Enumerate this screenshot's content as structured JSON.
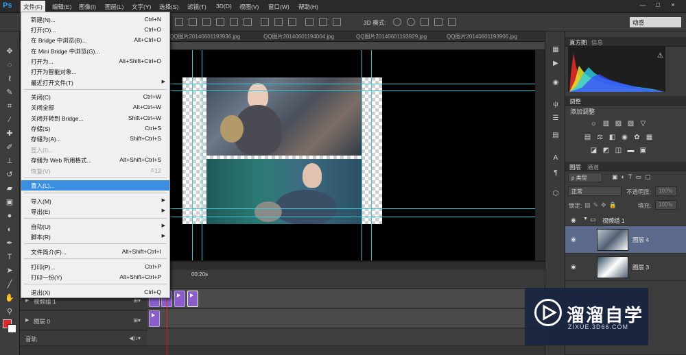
{
  "menubar": {
    "logo": "Ps",
    "items": [
      "文件(F)",
      "编辑(E)",
      "图像(I)",
      "图层(L)",
      "文字(Y)",
      "选择(S)",
      "滤镜(T)",
      "3D(D)",
      "视图(V)",
      "窗口(W)",
      "帮助(H)"
    ],
    "window_buttons": [
      "—",
      "□",
      "×"
    ]
  },
  "options_bar": {
    "mode3d_label": "3D 模式:",
    "workspace": "动感"
  },
  "doc_tabs": [
    "QQ图片20140601193936.jpg",
    "QQ图片20140601194004.jpg",
    "QQ图片20140601193929.jpg",
    "QQ图片20140601193906.jpg"
  ],
  "file_menu": {
    "items": [
      {
        "label": "新建(N)...",
        "shortcut": "Ctrl+N"
      },
      {
        "label": "打开(O)...",
        "shortcut": "Ctrl+O"
      },
      {
        "label": "在 Bridge 中浏览(B)...",
        "shortcut": "Alt+Ctrl+O"
      },
      {
        "label": "在 Mini Bridge 中浏览(G)...",
        "shortcut": ""
      },
      {
        "label": "打开为...",
        "shortcut": "Alt+Shift+Ctrl+O"
      },
      {
        "label": "打开为智能对象...",
        "shortcut": ""
      },
      {
        "label": "最近打开文件(T)",
        "shortcut": ""
      },
      {
        "label": "关闭(C)",
        "shortcut": "Ctrl+W"
      },
      {
        "label": "关闭全部",
        "shortcut": "Alt+Ctrl+W"
      },
      {
        "label": "关闭并转到 Bridge...",
        "shortcut": "Shift+Ctrl+W"
      },
      {
        "label": "存储(S)",
        "shortcut": "Ctrl+S"
      },
      {
        "label": "存储为(A)...",
        "shortcut": "Shift+Ctrl+S"
      },
      {
        "label": "签入(I)...",
        "shortcut": ""
      },
      {
        "label": "存储为 Web 所用格式...",
        "shortcut": "Alt+Shift+Ctrl+S"
      },
      {
        "label": "恢复(V)",
        "shortcut": "F12"
      },
      {
        "label": "置入(L)...",
        "shortcut": ""
      },
      {
        "label": "导入(M)",
        "shortcut": ""
      },
      {
        "label": "导出(E)",
        "shortcut": ""
      },
      {
        "label": "自动(U)",
        "shortcut": ""
      },
      {
        "label": "脚本(R)",
        "shortcut": ""
      },
      {
        "label": "文件简介(F)...",
        "shortcut": "Alt+Shift+Ctrl+I"
      },
      {
        "label": "打印(P)...",
        "shortcut": "Ctrl+P"
      },
      {
        "label": "打印一份(Y)",
        "shortcut": "Alt+Shift+Ctrl+P"
      },
      {
        "label": "退出(X)",
        "shortcut": "Ctrl+Q"
      }
    ]
  },
  "timeline": {
    "time_label": "00:20s",
    "rows": [
      "视频组 1",
      "图层 0",
      "音轨"
    ]
  },
  "panels": {
    "histogram_tabs": [
      "直方图",
      "信息"
    ],
    "adjust_tabs": [
      "调整"
    ],
    "adjust_title": "添加调整",
    "layers_tabs": [
      "图层",
      "通道"
    ],
    "kind_filter": "ρ 类型",
    "blend_mode": "正常",
    "opacity_label": "不透明度:",
    "opacity_value": "100%",
    "lock_label": "锁定:",
    "fill_label": "填充:",
    "fill_value": "100%",
    "group_name": "视频组 1",
    "layers": [
      {
        "name": "图层 4",
        "selected": true
      },
      {
        "name": "图层 3",
        "selected": false
      }
    ]
  },
  "watermark": {
    "brand_cn": "溜溜自学",
    "url": "ZIXUE.3D66.COM"
  },
  "colors": {
    "foreground": "#e8232b",
    "background": "#ffffff",
    "menu_highlight": "#3c8fe0",
    "guides": "#3fc4d6"
  }
}
